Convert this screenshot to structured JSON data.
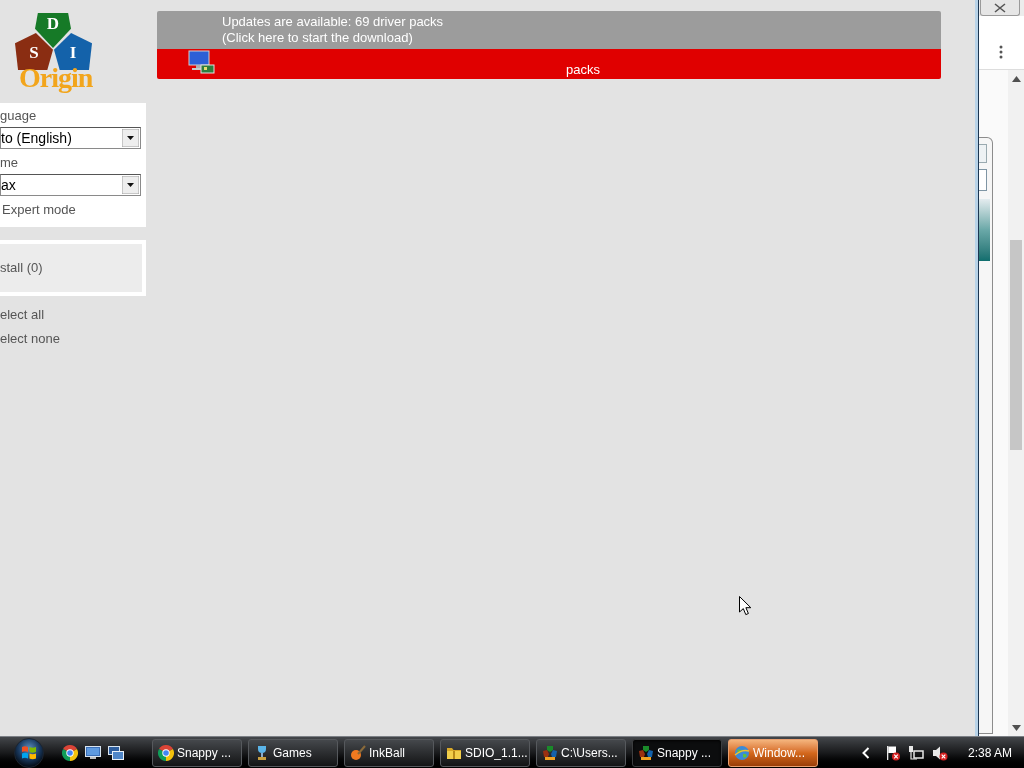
{
  "logo": {
    "letters": [
      "D",
      "S",
      "I"
    ],
    "wordmark": "Origin"
  },
  "settings": {
    "fields": [
      {
        "label": "guage",
        "value": "to (English)"
      },
      {
        "label": "me",
        "value": "ax"
      }
    ],
    "expert_mode_label": "Expert mode"
  },
  "install_button": {
    "label": "stall (0)"
  },
  "selection_links": [
    "elect all",
    "elect none"
  ],
  "update_banner": {
    "lines": [
      "Updates are available: 69 driver packs",
      "(Click here to start the download)"
    ]
  },
  "device_row": {
    "status_text": "packs"
  },
  "taskbar": {
    "tasks": [
      {
        "kind": "browser",
        "label": "Snappy ...",
        "selected": false,
        "flashing": false
      },
      {
        "kind": "games",
        "label": "Games",
        "selected": false,
        "flashing": false
      },
      {
        "kind": "ink",
        "label": "InkBall",
        "selected": false,
        "flashing": false
      },
      {
        "kind": "folder",
        "label": "SDIO_1.1...",
        "selected": false,
        "flashing": false
      },
      {
        "kind": "app",
        "label": "C:\\Users...",
        "selected": false,
        "flashing": false
      },
      {
        "kind": "app",
        "label": "Snappy ...",
        "selected": true,
        "flashing": false
      },
      {
        "kind": "web",
        "label": "Window...",
        "selected": false,
        "flashing": true
      }
    ],
    "clock": "2:38 AM"
  }
}
